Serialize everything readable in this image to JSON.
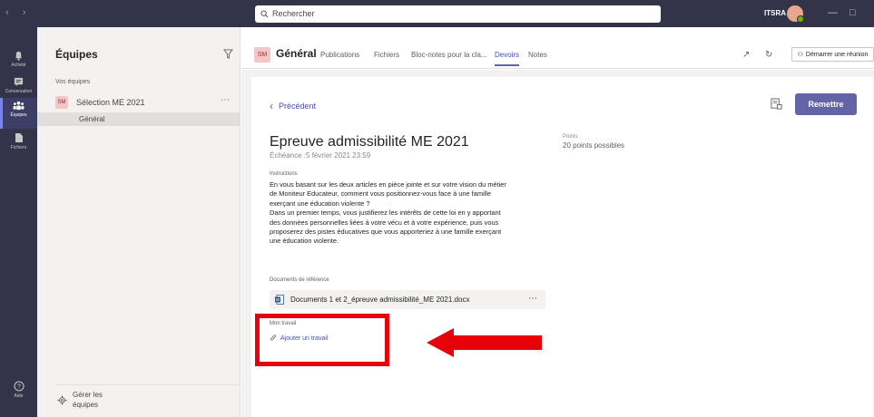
{
  "titlebar": {
    "search_placeholder": "Rechercher",
    "org": "ITSRA"
  },
  "rail": {
    "items": [
      {
        "label": "Activité",
        "icon": "bell-icon"
      },
      {
        "label": "Conversation",
        "icon": "chat-icon"
      },
      {
        "label": "Équipes",
        "icon": "teams-icon"
      },
      {
        "label": "Fichiers",
        "icon": "file-icon"
      }
    ],
    "help_label": "Aide"
  },
  "teams_panel": {
    "title": "Équipes",
    "section_label": "Vos équipes",
    "team": {
      "badge": "SM",
      "name": "Sélection ME 2021"
    },
    "channel": "Général",
    "manage_label": "Gérer les équipes"
  },
  "channel_header": {
    "badge": "SM",
    "title": "Général",
    "tabs": [
      "Publications",
      "Fichiers",
      "Bloc-notes pour la cla...",
      "Devoirs",
      "Notes"
    ],
    "active_tab": "Devoirs",
    "meeting_button": "Démarrer une réunion"
  },
  "assignment": {
    "back_label": "Précédent",
    "submit_label": "Remettre",
    "title": "Epreuve admissibilité ME 2021",
    "due": "Échéance :5 février 2021 23:59",
    "points_label": "Points",
    "points_value": "20 points possibles",
    "instructions_label": "Instructions",
    "instructions_lines": [
      "En vous basant sur les deux articles en pièce jointe et sur votre vision du métier",
      "de Moniteur Educateur, comment vous positionnez-vous face à une famille",
      "exerçant une éducation violente ?",
      "Dans un premier temps, vous justifierez les intérêts de cette loi en y apportant",
      "des données personnelles liées à votre vécu et à votre expérience, puis vous",
      "proposerez des pistes éducatives que vous apporteriez à une famille exerçant",
      "une éducation violente."
    ],
    "references_label": "Documents de référence",
    "reference_doc": "Documents 1 et 2_épreuve admissibilité_ME 2021.docx",
    "my_work_label": "Mon travail",
    "add_work_label": "Ajouter un travail"
  },
  "colors": {
    "rail": "#33344a",
    "accent": "#6264a7",
    "annotation": "#e8000b"
  }
}
